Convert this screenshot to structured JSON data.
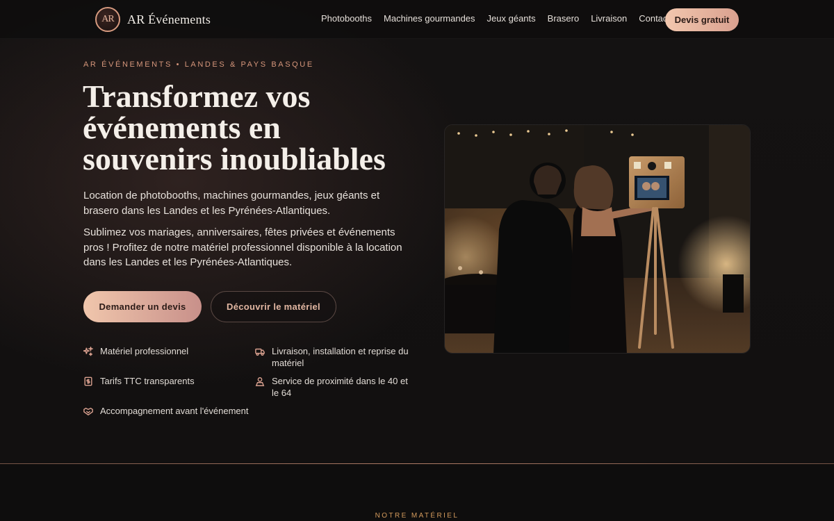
{
  "brand": {
    "logo_mark": "AR",
    "name": "AR Événements"
  },
  "nav": {
    "items": [
      {
        "label": "Photobooths"
      },
      {
        "label": "Machines gourmandes"
      },
      {
        "label": "Jeux géants"
      },
      {
        "label": "Brasero"
      },
      {
        "label": "Livraison"
      },
      {
        "label": "Contact"
      }
    ],
    "cta_label": "Devis gratuit"
  },
  "hero": {
    "eyebrow": "AR ÉVÉNEMENTS • LANDES & PAYS BASQUE",
    "title": "Transformez vos événements en souvenirs inoubliables",
    "lead": "Location de photobooths, machines gourmandes, jeux géants et brasero dans les Landes et les Pyrénées-Atlantiques.",
    "lead2": "Sublimez vos mariages, anniversaires, fêtes privées et événements pros ! Profitez de notre matériel professionnel disponible à la location dans les Landes et les Pyrénées-Atlantiques.",
    "primary_button": "Demander un devis",
    "secondary_button": "Découvrir le matériel",
    "features": [
      {
        "icon": "sparkles-icon",
        "label": "Matériel professionnel"
      },
      {
        "icon": "truck-icon",
        "label": "Livraison, installation et reprise du matériel"
      },
      {
        "icon": "receipt-icon",
        "label": "Tarifs TTC transparents"
      },
      {
        "icon": "location-person-icon",
        "label": "Service de proximité dans le 40 et le 64"
      },
      {
        "icon": "handshake-icon",
        "label": "Accompagnement avant l'événement"
      }
    ]
  },
  "section": {
    "eyebrow": "NOTRE MATÉRIEL"
  },
  "colors": {
    "accent": "#d9a08f",
    "accent_light": "#f2c7ae",
    "background": "#0f0e0e",
    "eyebrow_gold": "#d39a5c"
  }
}
